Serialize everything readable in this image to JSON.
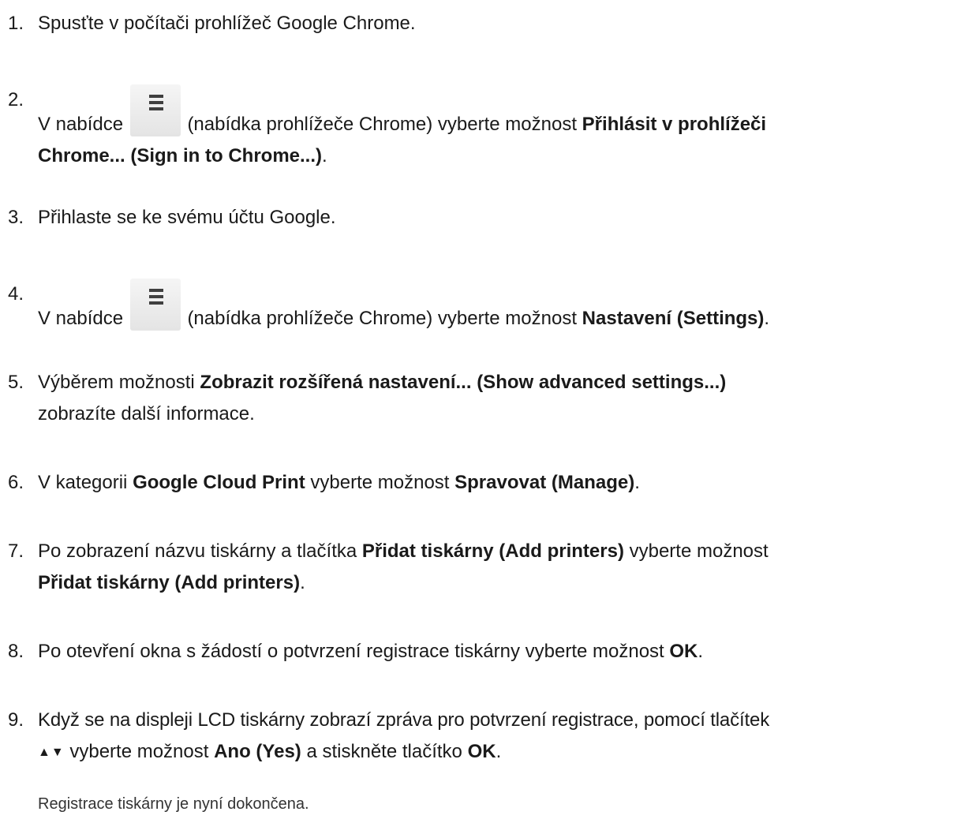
{
  "steps": [
    {
      "num": "1.",
      "text": "Spusťte v počítači prohlížeč Google Chrome."
    },
    {
      "num": "2.",
      "a": "V nabídce",
      "b": "(nabídka prohlížeče Chrome) vyberte možnost",
      "bold1": "Přihlásit v prohlížeči",
      "bold2": "Chrome... (Sign in to Chrome...)",
      "end": ".",
      "icon": "chrome-menu-icon"
    },
    {
      "num": "3.",
      "text": "Přihlaste se ke svému účtu Google."
    },
    {
      "num": "4.",
      "a": "V nabídce",
      "b": "(nabídka prohlížeče Chrome) vyberte možnost",
      "bold": "Nastavení (Settings)",
      "end": ".",
      "icon": "chrome-menu-icon"
    },
    {
      "num": "5.",
      "a": "Výběrem možnosti",
      "bold": "Zobrazit rozšířená nastavení... (Show advanced settings...)",
      "line2": "zobrazíte další informace."
    },
    {
      "num": "6.",
      "a": "V kategorii",
      "bold1": "Google Cloud Print",
      "b": "vyberte možnost",
      "bold2": "Spravovat (Manage)",
      "end": "."
    },
    {
      "num": "7.",
      "a": "Po zobrazení názvu tiskárny a tlačítka",
      "bold1": "Přidat tiskárny (Add printers)",
      "b": "vyberte možnost",
      "bold2": "Přidat tiskárny (Add printers)",
      "end": "."
    },
    {
      "num": "8.",
      "a": "Po otevření okna s žádostí o potvrzení registrace tiskárny vyberte možnost",
      "bold": "OK",
      "end": "."
    },
    {
      "num": "9.",
      "a": "Když se na displeji LCD tiskárny zobrazí zpráva pro potvrzení registrace, pomocí tlačítek",
      "arrows": "▲▼",
      "b": "vyberte možnost",
      "bold1": "Ano (Yes)",
      "c": "a stiskněte tlačítko",
      "bold2": "OK",
      "end": "."
    }
  ],
  "note": "Registrace tiskárny je nyní dokončena."
}
